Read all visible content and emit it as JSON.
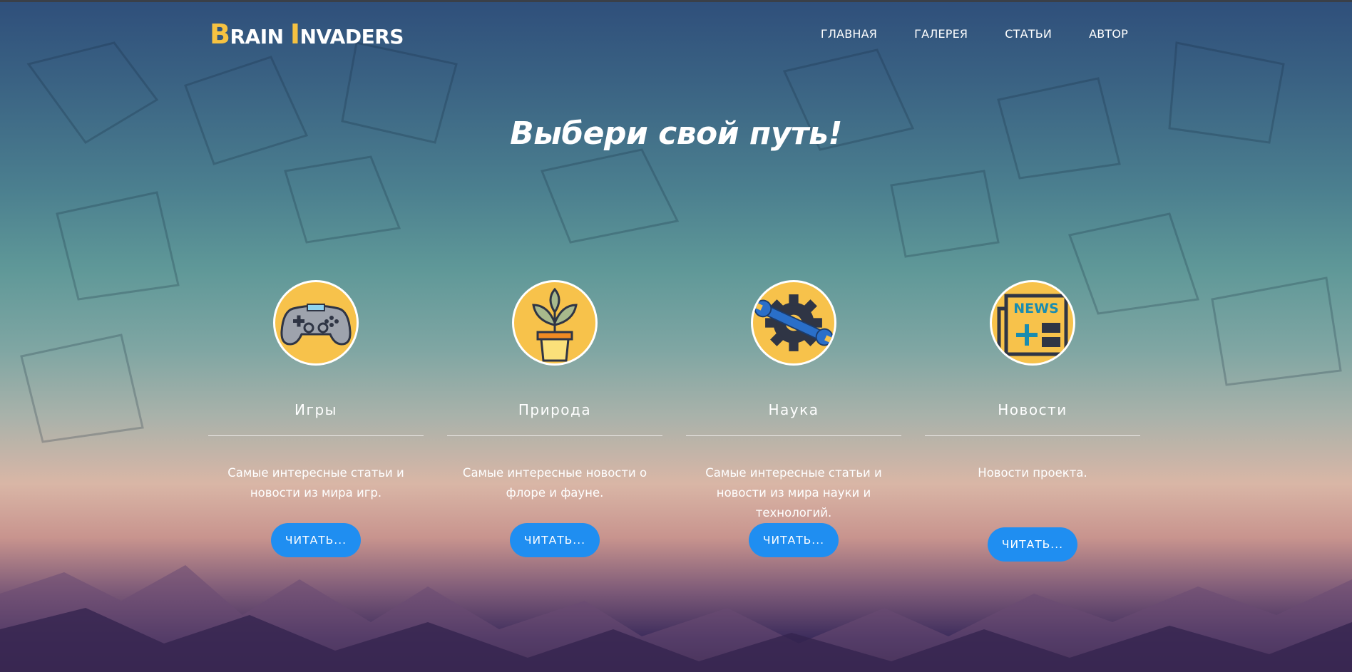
{
  "brand": {
    "b1": "B",
    "b2": "RAIN ",
    "b3": "I",
    "b4": "NVADERS"
  },
  "nav": [
    "ГЛАВНАЯ",
    "ГАЛЕРЕЯ",
    "СТАТЬИ",
    "АВТОР"
  ],
  "hero": {
    "title": "Выбери свой путь!"
  },
  "cards": [
    {
      "icon": "gamepad-icon",
      "title": "Игры",
      "desc": "Самые интересные статьи и новости из мира игр.",
      "button": "ЧИТАТЬ..."
    },
    {
      "icon": "plant-pot-icon",
      "title": "Природа",
      "desc": "Самые интересные новости о флоре и фауне.",
      "button": "ЧИТАТЬ..."
    },
    {
      "icon": "gear-wrench-icon",
      "title": "Наука",
      "desc": "Самые интересные статьи и новости из мира науки и технологий.",
      "button": "ЧИТАТЬ..."
    },
    {
      "icon": "newspaper-icon",
      "title": "Новости",
      "desc": "Новости проекта.",
      "button": "ЧИТАТЬ...",
      "icon_text": "NEWS"
    }
  ],
  "colors": {
    "accent": "#f6c241",
    "button": "#1f8ef1",
    "icon_bg": "#f7c24b"
  }
}
